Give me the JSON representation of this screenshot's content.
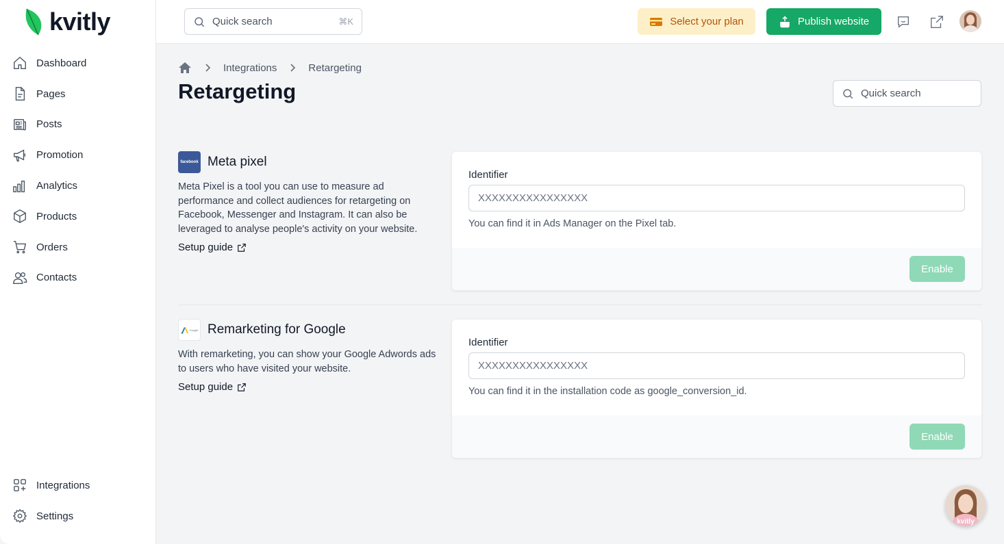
{
  "brand": {
    "name": "kvitly"
  },
  "sidebar": {
    "items": [
      {
        "label": "Dashboard",
        "icon": "home-icon"
      },
      {
        "label": "Pages",
        "icon": "file-icon"
      },
      {
        "label": "Posts",
        "icon": "newspaper-icon"
      },
      {
        "label": "Promotion",
        "icon": "megaphone-icon"
      },
      {
        "label": "Analytics",
        "icon": "bar-chart-icon"
      },
      {
        "label": "Products",
        "icon": "box-icon"
      },
      {
        "label": "Orders",
        "icon": "cart-icon"
      },
      {
        "label": "Contacts",
        "icon": "users-icon"
      }
    ],
    "bottom_items": [
      {
        "label": "Integrations",
        "icon": "integrations-icon"
      },
      {
        "label": "Settings",
        "icon": "gear-icon"
      }
    ]
  },
  "topbar": {
    "search_placeholder": "Quick search",
    "search_shortcut": "⌘K",
    "plan_label": "Select your plan",
    "publish_label": "Publish website"
  },
  "breadcrumb": {
    "items": [
      "Integrations",
      "Retargeting"
    ]
  },
  "page": {
    "title": "Retargeting",
    "search_placeholder": "Quick search"
  },
  "integrations": [
    {
      "title": "Meta pixel",
      "logo_text": "facebook",
      "description": "Meta Pixel is a tool you can use to measure ad performance and collect audiences for retargeting on Facebook, Messenger and Instagram. It can also be leveraged to analyse people's activity on your website.",
      "setup_label": "Setup guide",
      "field_label": "Identifier",
      "field_placeholder": "XXXXXXXXXXXXXXXX",
      "hint": "You can find it in Ads Manager on the Pixel tab.",
      "button_label": "Enable"
    },
    {
      "title": "Remarketing for Google",
      "logo_text": "Google",
      "description": "With remarketing, you can show your Google Adwords ads to users who have visited your website.",
      "setup_label": "Setup guide",
      "field_label": "Identifier",
      "field_placeholder": "XXXXXXXXXXXXXXXX",
      "hint": "You can find it in the installation code as google_conversion_id.",
      "button_label": "Enable"
    }
  ],
  "help": {
    "badge_text": "kvitly"
  },
  "colors": {
    "primary_green": "#16a866",
    "disabled_green": "#8fd9b6",
    "plan_bg": "#fdf0c8",
    "plan_text": "#b45309",
    "facebook_blue": "#3b5998"
  }
}
